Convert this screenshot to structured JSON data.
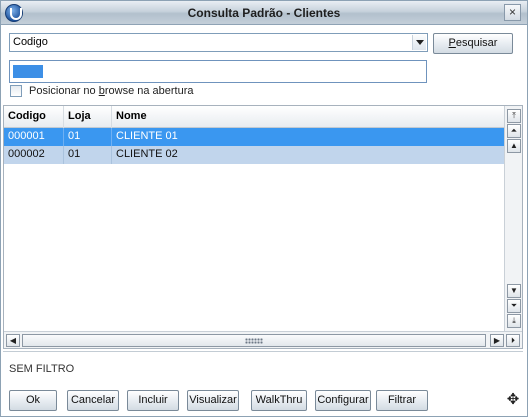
{
  "window": {
    "title": "Consulta Padrão - Clientes",
    "close_glyph": "×"
  },
  "search": {
    "index_selected": "Codigo",
    "button_label_prefix": "",
    "button_label_u": "P",
    "button_label_rest": "esquisar",
    "field_value": ""
  },
  "options": {
    "checkbox_label_pre": "Posicionar no ",
    "checkbox_label_u": "b",
    "checkbox_label_post": "rowse na abertura",
    "checked": false
  },
  "grid": {
    "columns": [
      "Codigo",
      "Loja",
      "Nome"
    ],
    "rows": [
      {
        "codigo": "000001",
        "loja": "01",
        "nome": "CLIENTE 01",
        "selected": true
      },
      {
        "codigo": "000002",
        "loja": "01",
        "nome": "CLIENTE 02",
        "selected": false
      }
    ]
  },
  "filter": {
    "text": "SEM FILTRO"
  },
  "buttons": {
    "ok": "Ok",
    "cancel": "Cancelar",
    "include": "Incluir",
    "view": "Visualizar",
    "walkthru": "WalkThru",
    "configure": "Configurar",
    "filter": "Filtrar"
  },
  "colors": {
    "selected_row": "#3a97f0",
    "normal_row": "#c1d5ec",
    "field_border": "#6f93bd"
  },
  "icons": {
    "app": "protheus-logo-icon",
    "move": "move-arrows-icon"
  }
}
